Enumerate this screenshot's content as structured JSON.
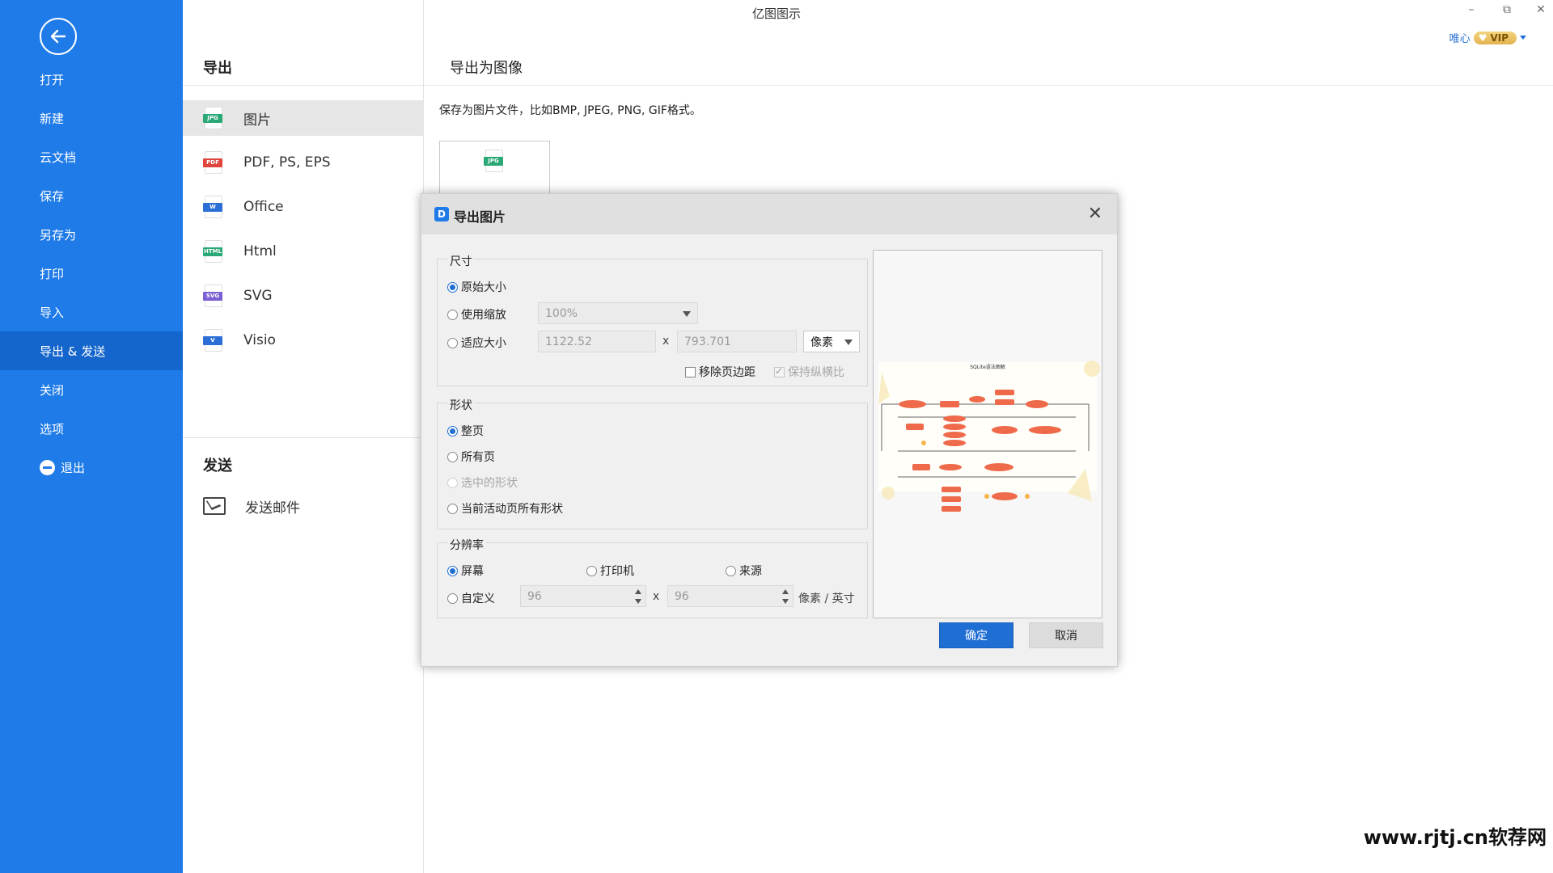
{
  "window": {
    "title": "亿图图示",
    "minimize": "–",
    "restore": "⧉",
    "close": "✕"
  },
  "user": {
    "name": "唯心",
    "badge": "VIP"
  },
  "sidebar": {
    "items": [
      {
        "label": "打开"
      },
      {
        "label": "新建"
      },
      {
        "label": "云文档"
      },
      {
        "label": "保存"
      },
      {
        "label": "另存为"
      },
      {
        "label": "打印"
      },
      {
        "label": "导入"
      },
      {
        "label": "导出 & 发送"
      },
      {
        "label": "关闭"
      },
      {
        "label": "选项"
      },
      {
        "label": "退出"
      }
    ],
    "active": "导出 & 发送"
  },
  "export": {
    "section_title": "导出",
    "formats": [
      {
        "label": "图片",
        "icon": "JPG",
        "color": "#2aa876"
      },
      {
        "label": "PDF, PS, EPS",
        "icon": "PDF",
        "color": "#e0453d"
      },
      {
        "label": "Office",
        "icon": "W",
        "color": "#2b6fd6"
      },
      {
        "label": "Html",
        "icon": "HTML",
        "color": "#2aa876"
      },
      {
        "label": "SVG",
        "icon": "SVG",
        "color": "#7b5fd3"
      },
      {
        "label": "Visio",
        "icon": "V",
        "color": "#2b6fd6"
      }
    ]
  },
  "send": {
    "section_title": "发送",
    "email_label": "发送邮件"
  },
  "content": {
    "heading": "导出为图像",
    "description": "保存为图片文件，比如BMP, JPEG, PNG, GIF格式。",
    "thumb_icon": "JPG"
  },
  "dialog": {
    "title": "导出图片",
    "icon": "D",
    "close": "✕",
    "size": {
      "title": "尺寸",
      "original": "原始大小",
      "use_scale": "使用缩放",
      "scale_value": "100%",
      "fit_size": "适应大小",
      "width": "1122.52",
      "x": "x",
      "height": "793.701",
      "unit": "像素",
      "remove_margin": "移除页边距",
      "keep_ratio": "保持纵横比"
    },
    "shape": {
      "title": "形状",
      "whole_page": "整页",
      "all_pages": "所有页",
      "selected_shapes": "选中的形状",
      "current_page_shapes": "当前活动页所有形状"
    },
    "resolution": {
      "title": "分辨率",
      "screen": "屏幕",
      "printer": "打印机",
      "source": "来源",
      "custom": "自定义",
      "dpi_x": "96",
      "x": "x",
      "dpi_y": "96",
      "unit": "像素 / 英寸"
    },
    "preview": {
      "title": "SQLite语法图解"
    },
    "ok": "确定",
    "cancel": "取消"
  },
  "watermark": "www.rjtj.cn软荐网"
}
